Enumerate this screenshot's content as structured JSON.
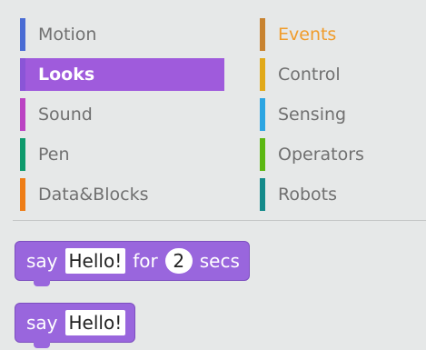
{
  "palette": {
    "left": [
      {
        "label": "Motion",
        "color": "#4a6cd4"
      },
      {
        "label": "Looks",
        "color": "#8a55d7",
        "selected": true
      },
      {
        "label": "Sound",
        "color": "#bb42c3"
      },
      {
        "label": "Pen",
        "color": "#0e9a6c"
      },
      {
        "label": "Data&Blocks",
        "color": "#ee7d16"
      }
    ],
    "right": [
      {
        "label": "Events",
        "color": "#c88330",
        "active": true
      },
      {
        "label": "Control",
        "color": "#e1a91a"
      },
      {
        "label": "Sensing",
        "color": "#2ca5e2"
      },
      {
        "label": "Operators",
        "color": "#5cb712"
      },
      {
        "label": "Robots",
        "color": "#148a8a"
      }
    ]
  },
  "blocks": [
    {
      "say": "say",
      "text": "Hello!",
      "for": "for",
      "secs_value": "2",
      "secs": "secs"
    },
    {
      "say": "say",
      "text": "Hello!"
    }
  ]
}
